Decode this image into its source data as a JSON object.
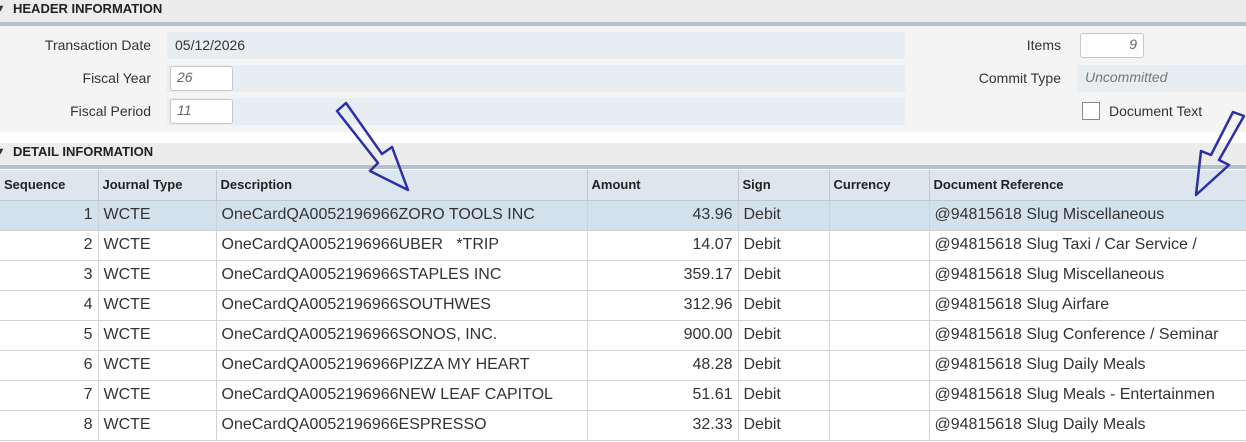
{
  "header_section": {
    "title": "HEADER INFORMATION",
    "transaction_date_label": "Transaction Date",
    "transaction_date_value": "05/12/2026",
    "fiscal_year_label": "Fiscal Year",
    "fiscal_year_value": "26",
    "fiscal_period_label": "Fiscal Period",
    "fiscal_period_value": "11",
    "items_label": "Items",
    "items_value": "9",
    "commit_type_label": "Commit Type",
    "commit_type_value": "Uncommitted",
    "document_text_label": "Document Text",
    "document_text_checked": false
  },
  "detail_section": {
    "title": "DETAIL INFORMATION",
    "columns": [
      "Sequence",
      "Journal Type",
      "Description",
      "Amount",
      "Sign",
      "Currency",
      "Document Reference"
    ],
    "rows": [
      {
        "seq": "1",
        "type": "WCTE",
        "desc": "OneCardQA0052196966ZORO TOOLS INC",
        "amount": "43.96",
        "sign": "Debit",
        "currency": "",
        "ref": "@94815618 Slug Miscellaneous"
      },
      {
        "seq": "2",
        "type": "WCTE",
        "desc": "OneCardQA0052196966UBER   *TRIP",
        "amount": "14.07",
        "sign": "Debit",
        "currency": "",
        "ref": "@94815618 Slug Taxi / Car Service /"
      },
      {
        "seq": "3",
        "type": "WCTE",
        "desc": "OneCardQA0052196966STAPLES INC",
        "amount": "359.17",
        "sign": "Debit",
        "currency": "",
        "ref": "@94815618 Slug Miscellaneous"
      },
      {
        "seq": "4",
        "type": "WCTE",
        "desc": "OneCardQA0052196966SOUTHWES",
        "amount": "312.96",
        "sign": "Debit",
        "currency": "",
        "ref": "@94815618 Slug Airfare"
      },
      {
        "seq": "5",
        "type": "WCTE",
        "desc": "OneCardQA0052196966SONOS, INC.",
        "amount": "900.00",
        "sign": "Debit",
        "currency": "",
        "ref": "@94815618 Slug Conference / Seminar"
      },
      {
        "seq": "6",
        "type": "WCTE",
        "desc": "OneCardQA0052196966PIZZA MY HEART",
        "amount": "48.28",
        "sign": "Debit",
        "currency": "",
        "ref": "@94815618 Slug Daily Meals"
      },
      {
        "seq": "7",
        "type": "WCTE",
        "desc": "OneCardQA0052196966NEW LEAF CAPITOL",
        "amount": "51.61",
        "sign": "Debit",
        "currency": "",
        "ref": "@94815618 Slug Meals - Entertainmen"
      },
      {
        "seq": "8",
        "type": "WCTE",
        "desc": "OneCardQA0052196966ESPRESSO",
        "amount": "32.33",
        "sign": "Debit",
        "currency": "",
        "ref": "@94815618 Slug Daily Meals"
      }
    ],
    "selected_row": 0
  },
  "annotations": {
    "arrow_color": "#2b2fa8",
    "icons": [
      "collapse-chevron-icon",
      "annotation-arrow"
    ]
  }
}
